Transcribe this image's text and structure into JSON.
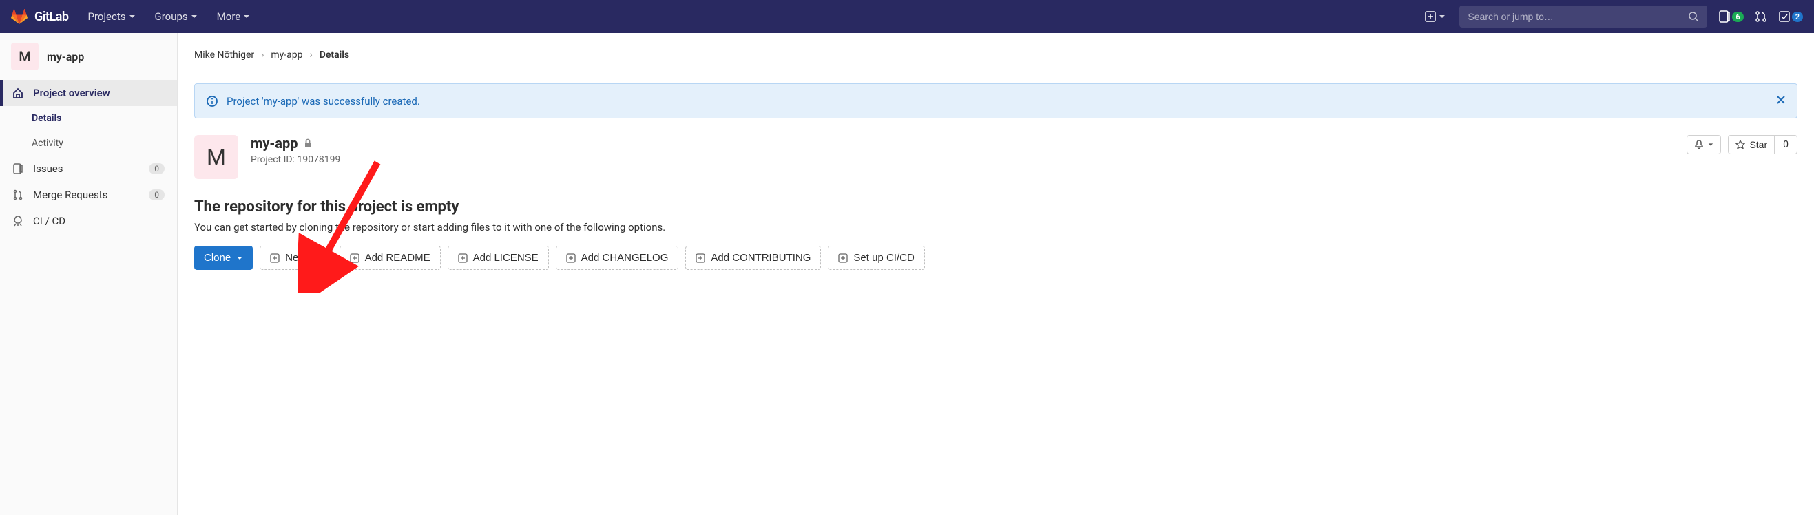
{
  "header": {
    "brand": "GitLab",
    "nav": [
      "Projects",
      "Groups",
      "More"
    ],
    "search_placeholder": "Search or jump to…",
    "issues_badge": "6",
    "todo_badge": "2"
  },
  "sidebar": {
    "project_letter": "M",
    "project_name": "my-app",
    "overview_label": "Project overview",
    "details_label": "Details",
    "activity_label": "Activity",
    "issues_label": "Issues",
    "issues_count": "0",
    "mr_label": "Merge Requests",
    "mr_count": "0",
    "cicd_label": "CI / CD"
  },
  "breadcrumbs": {
    "owner": "Mike Nöthiger",
    "project": "my-app",
    "page": "Details"
  },
  "alert": {
    "message": "Project 'my-app' was successfully created."
  },
  "project": {
    "letter": "M",
    "name": "my-app",
    "id_prefix": "Project ID:",
    "id": "19078199",
    "notifications_label": "",
    "star_label": "Star",
    "star_count": "0"
  },
  "empty": {
    "heading": "The repository for this project is empty",
    "desc": "You can get started by cloning the repository or start adding files to it with one of the following options."
  },
  "actions": {
    "clone": "Clone",
    "new_file": "New file",
    "add_readme": "Add README",
    "add_license": "Add LICENSE",
    "add_changelog": "Add CHANGELOG",
    "add_contributing": "Add CONTRIBUTING",
    "setup_cicd": "Set up CI/CD"
  }
}
